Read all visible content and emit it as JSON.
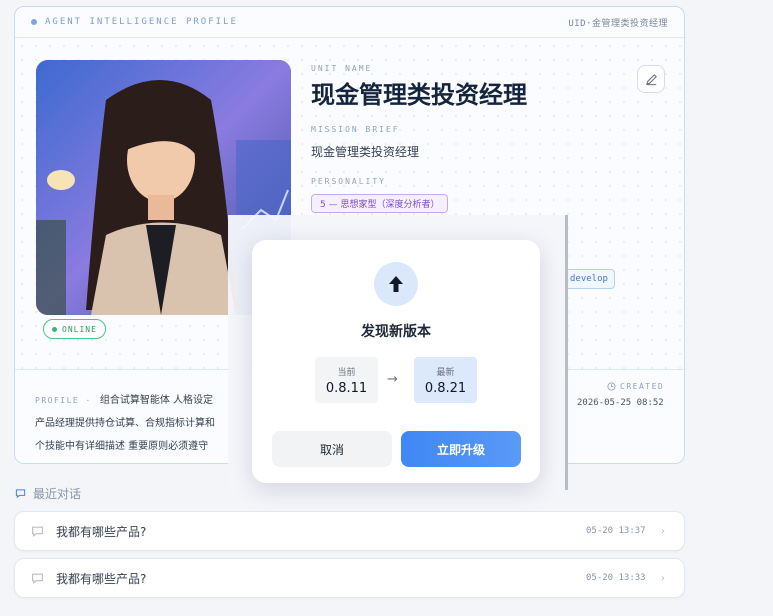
{
  "card": {
    "header_label": "AGENT INTELLIGENCE PROFILE",
    "uid": "UID·金管理类投资经理",
    "status": "ONLINE",
    "unit_name_label": "UNIT NAME",
    "unit_name": "现金管理类投资经理",
    "mission_label": "MISSION BRIEF",
    "mission": "现金管理类投资经理",
    "personality_label": "PERSONALITY",
    "personality": "5 — 思想家型（深度分析者）",
    "tag": "develop",
    "profile_label": "PROFILE ·",
    "profile_lines": [
      "组合试算智能体 人格设定  ",
      "产品经理提供持仓试算、合规指标计算和",
      "个技能中有详细描述 重要原则必须遵守"
    ],
    "created_label": "CREATED",
    "created_value": "2026-05-25 08:52"
  },
  "recent": {
    "title": "最近对话",
    "items": [
      {
        "question": "我都有哪些产品?",
        "time": "05-20 13:37"
      },
      {
        "question": "我都有哪些产品?",
        "time": "05-20 13:33"
      }
    ]
  },
  "dialog": {
    "title": "发现新版本",
    "current_label": "当前",
    "current_version": "0.8.11",
    "latest_label": "最新",
    "latest_version": "0.8.21",
    "arrow": "→",
    "cancel": "取消",
    "upgrade": "立即升级"
  },
  "colors": {
    "accent": "#3f87f5",
    "online": "#38b77a",
    "personality": "#7c4bc4"
  }
}
